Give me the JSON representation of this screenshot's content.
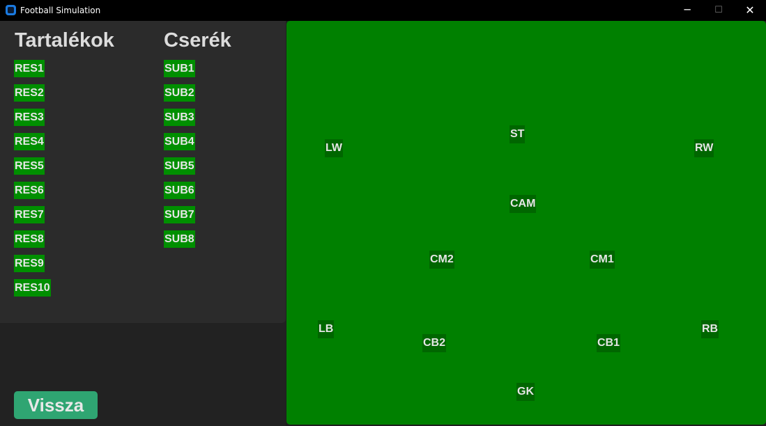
{
  "window": {
    "title": "Football Simulation",
    "minimize_glyph": "─",
    "maximize_glyph": "☐",
    "close_glyph": "✕"
  },
  "reserves": {
    "heading": "Tartalékok",
    "items": [
      "RES1",
      "RES2",
      "RES3",
      "RES4",
      "RES5",
      "RES6",
      "RES7",
      "RES8",
      "RES9",
      "RES10"
    ]
  },
  "substitutes": {
    "heading": "Cserék",
    "items": [
      "SUB1",
      "SUB2",
      "SUB3",
      "SUB4",
      "SUB5",
      "SUB6",
      "SUB7",
      "SUB8"
    ]
  },
  "back_button": {
    "label": "Vissza"
  },
  "pitch": {
    "positions": {
      "st": "ST",
      "lw": "LW",
      "rw": "RW",
      "cam": "CAM",
      "cm2": "CM2",
      "cm1": "CM1",
      "lb": "LB",
      "rb": "RB",
      "cb2": "CB2",
      "cb1": "CB1",
      "gk": "GK"
    }
  },
  "colors": {
    "pitch": "#008000",
    "position_marker": "#006600",
    "list_chip": "#008f00",
    "back_button": "#2fa572"
  }
}
